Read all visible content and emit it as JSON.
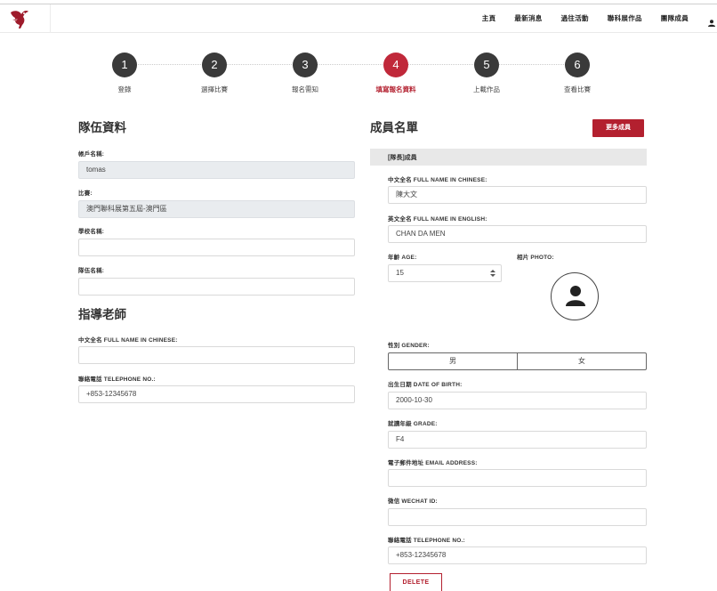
{
  "nav": {
    "links": [
      "主頁",
      "最新消息",
      "過往活動",
      "聯科展作品",
      "團隊成員"
    ]
  },
  "steps": [
    {
      "num": "1",
      "label": "登錄"
    },
    {
      "num": "2",
      "label": "選擇比賽"
    },
    {
      "num": "3",
      "label": "報名需知"
    },
    {
      "num": "4",
      "label": "填寫報名資料",
      "active": true
    },
    {
      "num": "5",
      "label": "上載作品"
    },
    {
      "num": "6",
      "label": "查看比賽"
    }
  ],
  "team": {
    "title": "隊伍資料",
    "account_label": "帳戶名稱:",
    "account_value": "tomas",
    "competition_label": "比賽:",
    "competition_value": "澳門聯科展第五屆-澳門區",
    "school_label": "學校名稱:",
    "school_value": "",
    "team_name_label": "隊伍名稱:",
    "team_name_value": ""
  },
  "teacher": {
    "title": "指導老師",
    "name_label": "中文全名 FULL NAME IN CHINESE:",
    "name_value": "",
    "phone_label": "聯絡電話 TELEPHONE NO.:",
    "phone_value": "+853-12345678"
  },
  "members": {
    "title": "成員名單",
    "more_button": "更多成員",
    "captain_label": "[隊長]成員",
    "cn_name_label": "中文全名 FULL NAME IN CHINESE:",
    "cn_name_value": "陳大文",
    "en_name_label": "英文全名 FULL NAME IN ENGLISH:",
    "en_name_value": "CHAN DA MEN",
    "age_label": "年齡 AGE:",
    "age_value": "15",
    "photo_label": "相片 PHOTO:",
    "gender_label": "性別 GENDER:",
    "gender_options": [
      "男",
      "女"
    ],
    "dob_label": "出生日期 DATE OF BIRTH:",
    "dob_value": "2000-10-30",
    "grade_label": "就讀年級 GRADE:",
    "grade_value": "F4",
    "email_label": "電子郵件地址 EMAIL ADDRESS:",
    "email_value": "",
    "wechat_label": "微信 WECHAT ID:",
    "wechat_value": "",
    "phone_label": "聯絡電話 TELEPHONE NO.:",
    "phone_value": "+853-12345678",
    "delete_button": "DELETE"
  },
  "colors": {
    "accent": "#b3202f",
    "step_inactive": "#3a3a3a",
    "disabled_field": "#e9ecef"
  },
  "icons": {
    "logo": "crane-logo-icon",
    "user": "user-icon",
    "avatar": "avatar-placeholder-icon",
    "spinner": "number-spinner-icon"
  }
}
